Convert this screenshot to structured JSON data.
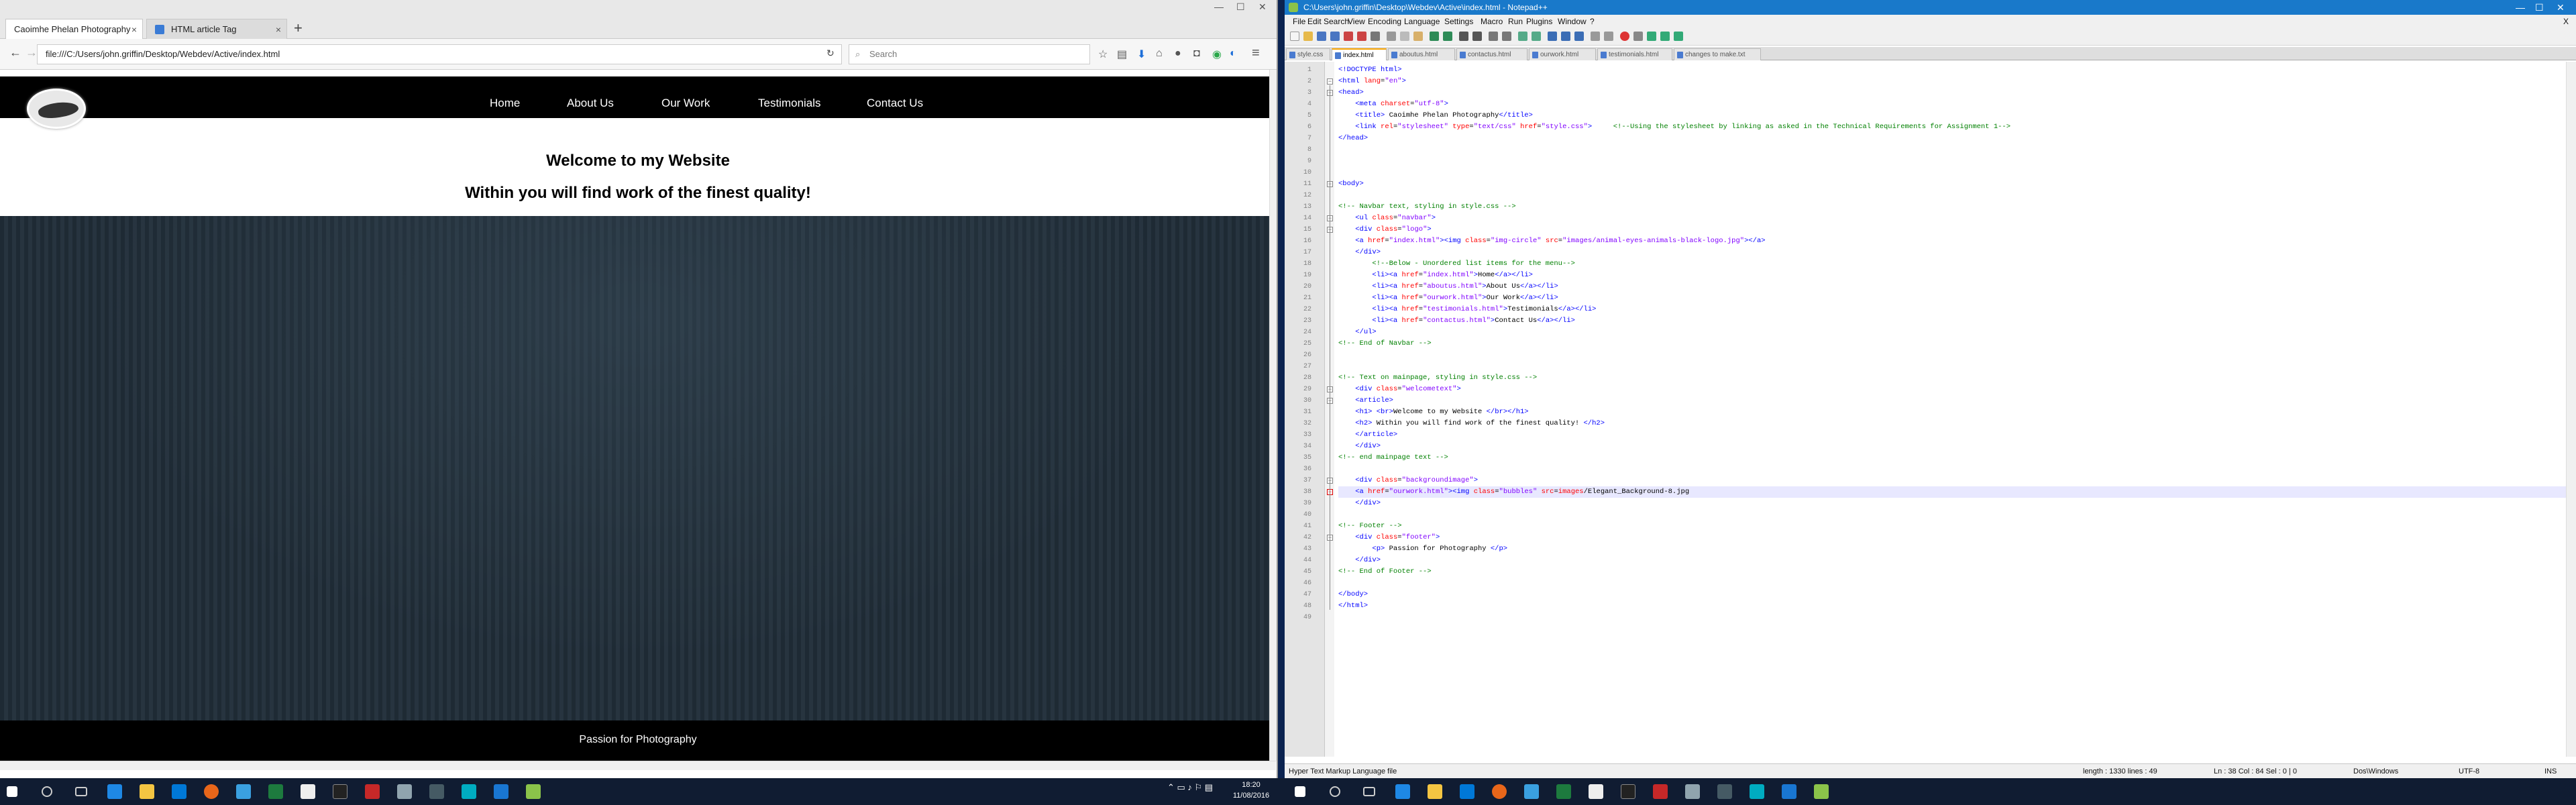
{
  "browser": {
    "tabs": [
      {
        "label": "Caoimhe Phelan Photography",
        "close": "×"
      },
      {
        "label": "HTML article Tag",
        "close": "×"
      }
    ],
    "newtab": "+",
    "url": "file:///C:/Users/john.griffin/Desktop/Webdev/Active/index.html",
    "search_placeholder": "Search",
    "window_controls": [
      "—",
      "☐",
      "✕"
    ]
  },
  "site": {
    "nav_items": [
      "Home",
      "About Us",
      "Our Work",
      "Testimonials",
      "Contact Us"
    ],
    "welcome": "Welcome to my Website",
    "subtitle": "Within you will find work of the finest quality!",
    "footer": "Passion for Photography"
  },
  "npp": {
    "title": "C:\\Users\\john.griffin\\Desktop\\Webdev\\Active\\index.html - Notepad++",
    "menu": [
      "File",
      "Edit",
      "Search",
      "View",
      "Encoding",
      "Language",
      "Settings",
      "Macro",
      "Run",
      "Plugins",
      "Window",
      "?"
    ],
    "close_x": "X",
    "tabs": [
      "style.css",
      "index.html",
      "aboutus.html",
      "contactus.html",
      "ourwork.html",
      "testimonials.html",
      "changes to make.txt"
    ],
    "active_tab": 1,
    "status": {
      "type": "Hyper Text Markup Language file",
      "length": "length : 1330   lines : 49",
      "pos": "Ln : 38   Col : 84   Sel : 0 | 0",
      "eol": "Dos\\Windows",
      "encoding": "UTF-8",
      "ins": "INS"
    },
    "code": [
      {
        "n": 1,
        "html": "<span class='t'>&lt;!DOCTYPE html&gt;</span>"
      },
      {
        "n": 2,
        "html": "<span class='t'>&lt;html</span> <span class='a'>lang</span>=<span class='v'>\"en\"</span><span class='t'>&gt;</span>"
      },
      {
        "n": 3,
        "html": "<span class='t'>&lt;head&gt;</span>"
      },
      {
        "n": 4,
        "html": "    <span class='t'>&lt;meta</span> <span class='a'>charset</span>=<span class='v'>\"utf-8\"</span><span class='t'>&gt;</span>"
      },
      {
        "n": 5,
        "html": "    <span class='t'>&lt;title&gt;</span> Caoimhe Phelan Photography<span class='t'>&lt;/title&gt;</span>"
      },
      {
        "n": 6,
        "html": "    <span class='t'>&lt;link</span> <span class='a'>rel</span>=<span class='v'>\"stylesheet\"</span> <span class='a'>type</span>=<span class='v'>\"text/css\"</span> <span class='a'>href</span>=<span class='v'>\"style.css\"</span><span class='t'>&gt;</span>     <span class='c'>&lt;!--Using the stylesheet by linking as asked in the Technical Requirements for Assignment 1--&gt;</span>"
      },
      {
        "n": 7,
        "html": "<span class='t'>&lt;/head&gt;</span>"
      },
      {
        "n": 8,
        "html": ""
      },
      {
        "n": 9,
        "html": ""
      },
      {
        "n": 10,
        "html": ""
      },
      {
        "n": 11,
        "html": "<span class='t'>&lt;body&gt;</span>"
      },
      {
        "n": 12,
        "html": ""
      },
      {
        "n": 13,
        "html": "<span class='c'>&lt;!-- Navbar text, styling in style.css --&gt;</span>"
      },
      {
        "n": 14,
        "html": "    <span class='t'>&lt;ul</span> <span class='a'>class</span>=<span class='v'>\"navbar\"</span><span class='t'>&gt;</span>"
      },
      {
        "n": 15,
        "html": "    <span class='t'>&lt;div</span> <span class='a'>class</span>=<span class='v'>\"logo\"</span><span class='t'>&gt;</span>"
      },
      {
        "n": 16,
        "html": "    <span class='t'>&lt;a</span> <span class='a'>href</span>=<span class='v'>\"index.html\"</span><span class='t'>&gt;&lt;img</span> <span class='a'>class</span>=<span class='v'>\"img-circle\"</span> <span class='a'>src</span>=<span class='v'>\"images/animal-eyes-animals-black-logo.jpg\"</span><span class='t'>&gt;&lt;/a&gt;</span>"
      },
      {
        "n": 17,
        "html": "    <span class='t'>&lt;/div&gt;</span>"
      },
      {
        "n": 18,
        "html": "        <span class='c'>&lt;!--Below - Unordered list items for the menu--&gt;</span>"
      },
      {
        "n": 19,
        "html": "        <span class='t'>&lt;li&gt;&lt;a</span> <span class='a'>href</span>=<span class='v'>\"index.html\"</span><span class='t'>&gt;</span>Home<span class='t'>&lt;/a&gt;&lt;/li&gt;</span>"
      },
      {
        "n": 20,
        "html": "        <span class='t'>&lt;li&gt;&lt;a</span> <span class='a'>href</span>=<span class='v'>\"aboutus.html\"</span><span class='t'>&gt;</span>About Us<span class='t'>&lt;/a&gt;&lt;/li&gt;</span>"
      },
      {
        "n": 21,
        "html": "        <span class='t'>&lt;li&gt;&lt;a</span> <span class='a'>href</span>=<span class='v'>\"ourwork.html\"</span><span class='t'>&gt;</span>Our Work<span class='t'>&lt;/a&gt;&lt;/li&gt;</span>"
      },
      {
        "n": 22,
        "html": "        <span class='t'>&lt;li&gt;&lt;a</span> <span class='a'>href</span>=<span class='v'>\"testimonials.html\"</span><span class='t'>&gt;</span>Testimonials<span class='t'>&lt;/a&gt;&lt;/li&gt;</span>"
      },
      {
        "n": 23,
        "html": "        <span class='t'>&lt;li&gt;&lt;a</span> <span class='a'>href</span>=<span class='v'>\"contactus.html\"</span><span class='t'>&gt;</span>Contact Us<span class='t'>&lt;/a&gt;&lt;/li&gt;</span>"
      },
      {
        "n": 24,
        "html": "    <span class='t'>&lt;/ul&gt;</span>"
      },
      {
        "n": 25,
        "html": "<span class='c'>&lt;!-- End of Navbar --&gt;</span>"
      },
      {
        "n": 26,
        "html": ""
      },
      {
        "n": 27,
        "html": ""
      },
      {
        "n": 28,
        "html": "<span class='c'>&lt;!-- Text on mainpage, styling in style.css --&gt;</span>"
      },
      {
        "n": 29,
        "html": "    <span class='t'>&lt;div</span> <span class='a'>class</span>=<span class='v'>\"welcometext\"</span><span class='t'>&gt;</span>"
      },
      {
        "n": 30,
        "html": "    <span class='t'>&lt;article&gt;</span>"
      },
      {
        "n": 31,
        "html": "    <span class='t'>&lt;h1&gt;</span> <span class='t'>&lt;br&gt;</span>Welcome to my Website <span class='t'>&lt;/br&gt;&lt;/h1&gt;</span>"
      },
      {
        "n": 32,
        "html": "    <span class='t'>&lt;h2&gt;</span> Within you will find work of the finest quality! <span class='t'>&lt;/h2&gt;</span>"
      },
      {
        "n": 33,
        "html": "    <span class='t'>&lt;/article&gt;</span>"
      },
      {
        "n": 34,
        "html": "    <span class='t'>&lt;/div&gt;</span>"
      },
      {
        "n": 35,
        "html": "<span class='c'>&lt;!-- end mainpage text --&gt;</span>"
      },
      {
        "n": 36,
        "html": ""
      },
      {
        "n": 37,
        "html": "    <span class='t'>&lt;div</span> <span class='a'>class</span>=<span class='v'>\"backgroundimage\"</span><span class='t'>&gt;</span>"
      },
      {
        "n": 38,
        "html": "    <span class='t'>&lt;a</span> <span class='a'>href</span>=<span class='v'>\"ourwork.html\"</span><span class='t'>&gt;&lt;img</span> <span class='a'>class</span>=<span class='v'>\"bubbles\"</span> <span class='a'>src</span>=<span class='a'>images</span>/Elegant_Background-8.jpg"
      },
      {
        "n": 39,
        "html": "    <span class='t'>&lt;/div&gt;</span>"
      },
      {
        "n": 40,
        "html": ""
      },
      {
        "n": 41,
        "html": "<span class='c'>&lt;!-- Footer --&gt;</span>"
      },
      {
        "n": 42,
        "html": "    <span class='t'>&lt;div</span> <span class='a'>class</span>=<span class='v'>\"footer\"</span><span class='t'>&gt;</span>"
      },
      {
        "n": 43,
        "html": "        <span class='t'>&lt;p&gt;</span> Passion for Photography <span class='t'>&lt;/p&gt;</span>"
      },
      {
        "n": 44,
        "html": "    <span class='t'>&lt;/div&gt;</span>"
      },
      {
        "n": 45,
        "html": "<span class='c'>&lt;!-- End of Footer --&gt;</span>"
      },
      {
        "n": 46,
        "html": ""
      },
      {
        "n": 47,
        "html": "<span class='t'>&lt;/body&gt;</span>"
      },
      {
        "n": 48,
        "html": "<span class='t'>&lt;/html&gt;</span>"
      },
      {
        "n": 49,
        "html": ""
      }
    ]
  },
  "taskbar": {
    "time": "18:20",
    "date": "11/08/2016",
    "lang": "ENG"
  },
  "colors": {
    "taskbar": "#101c32",
    "npp_title": "#1979ca",
    "active_tab_accent": "#f4a100"
  }
}
